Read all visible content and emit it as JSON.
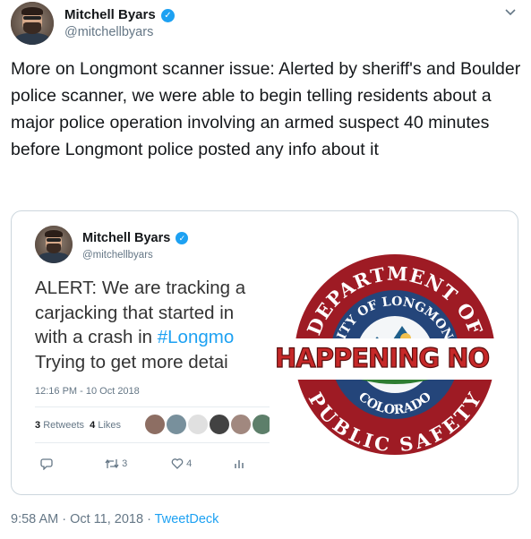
{
  "tweet": {
    "author_name": "Mitchell Byars",
    "author_handle": "@mitchellbyars",
    "text": "More on Longmont scanner issue: Alerted by sheriff's and Boulder police scanner, we were able to begin telling residents about a major police operation involving an armed suspect 40 minutes before Longmont police posted any info about it",
    "timestamp": "9:58 AM · Oct 11, 2018",
    "separator": " · ",
    "source": "TweetDeck"
  },
  "embedded_screenshot": {
    "author_name": "Mitchell Byars",
    "author_handle": "@mitchellbyars",
    "text_lines": [
      "ALERT: We are tracking a",
      "carjacking that started in",
      "with a crash in ",
      "Trying to get more detai"
    ],
    "hashtag": "#Longmo",
    "timestamp": "12:16 PM - 10 Oct 2018",
    "retweets_count": "3",
    "retweets_label": "Retweets",
    "likes_count": "4",
    "likes_label": "Likes",
    "reply_count": "",
    "retweet_action_count": "3",
    "like_action_count": "4",
    "logo": {
      "top_arc": "DEPARTMENT OF",
      "city_arc": "CITY OF LONGMONT",
      "state": "COLORADO",
      "bottom_arc": "PUBLIC SAFETY"
    },
    "banner_text": "HAPPENING NO"
  },
  "icons": {
    "verified": "verified-badge-icon",
    "chevron": "chevron-down-icon",
    "reply": "reply-icon",
    "retweet": "retweet-icon",
    "like": "heart-icon",
    "analytics": "analytics-icon"
  },
  "colors": {
    "link": "#1da1f2",
    "banner_red": "#c62828",
    "seal_blue": "#24457a",
    "seal_red": "#9e1b24"
  }
}
